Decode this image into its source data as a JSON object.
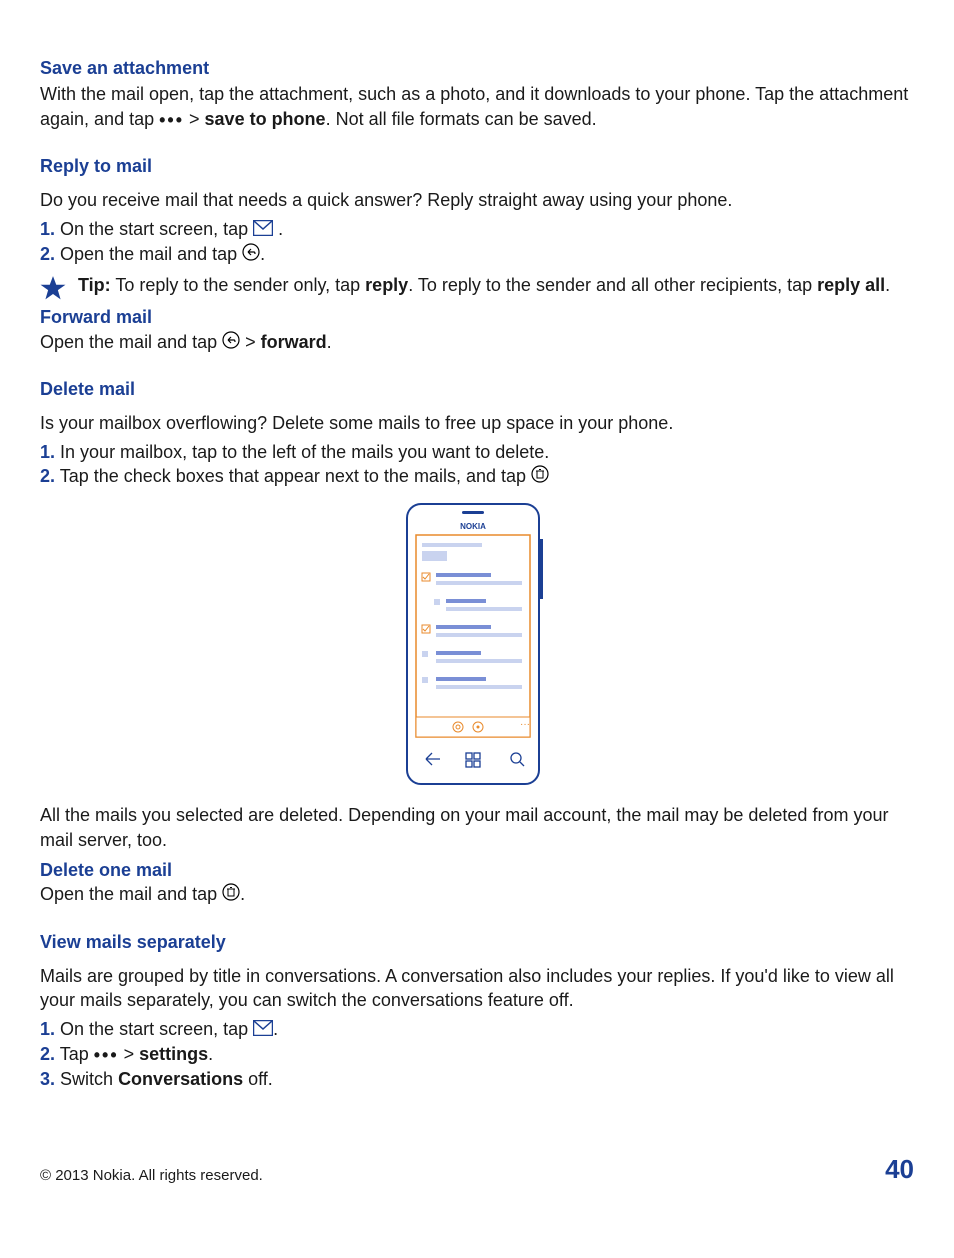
{
  "section1": {
    "heading": "Save an attachment",
    "body_pre": "With the mail open, tap the attachment, such as a photo, and it downloads to your phone. Tap the attachment again, and tap ",
    "body_mid": " > ",
    "body_bold": "save to phone",
    "body_post": ". Not all file formats can be saved."
  },
  "section2": {
    "heading": "Reply to mail",
    "intro": "Do you receive mail that needs a quick answer? Reply straight away using your phone.",
    "step1_pre": "On the start screen, tap ",
    "step1_post": " .",
    "step2_pre": "Open the mail and tap ",
    "step2_post": ".",
    "tip_label": "Tip:",
    "tip_pre": " To reply to the sender only, tap ",
    "tip_b1": "reply",
    "tip_mid": ". To reply to the sender and all other recipients, tap ",
    "tip_b2": "reply all",
    "tip_post": "."
  },
  "section3": {
    "heading": "Forward mail",
    "body_pre": "Open the mail and tap ",
    "body_mid": " > ",
    "body_bold": "forward",
    "body_post": "."
  },
  "section4": {
    "heading": "Delete mail",
    "intro": "Is your mailbox overflowing? Delete some mails to free up space in your phone.",
    "step1": "In your mailbox, tap to the left of the mails you want to delete.",
    "step2_pre": "Tap the check boxes that appear next to the mails, and tap ",
    "after": "All the mails you selected are deleted. Depending on your mail account, the mail may be deleted from your mail server, too."
  },
  "section5": {
    "heading": "Delete one mail",
    "body_pre": "Open the mail and tap ",
    "body_post": "."
  },
  "section6": {
    "heading": "View mails separately",
    "intro": "Mails are grouped by title in conversations. A conversation also includes your replies. If you'd like to view all your mails separately, you can switch the conversations feature off.",
    "step1_pre": "On the start screen, tap ",
    "step1_post": ".",
    "step2_pre": "Tap ",
    "step2_mid": " > ",
    "step2_bold": "settings",
    "step2_post": ".",
    "step3_pre": "Switch ",
    "step3_bold": "Conversations",
    "step3_post": " off."
  },
  "footer": {
    "copyright": "© 2013 Nokia. All rights reserved.",
    "page": "40"
  },
  "phone_brand": "NOKIA"
}
